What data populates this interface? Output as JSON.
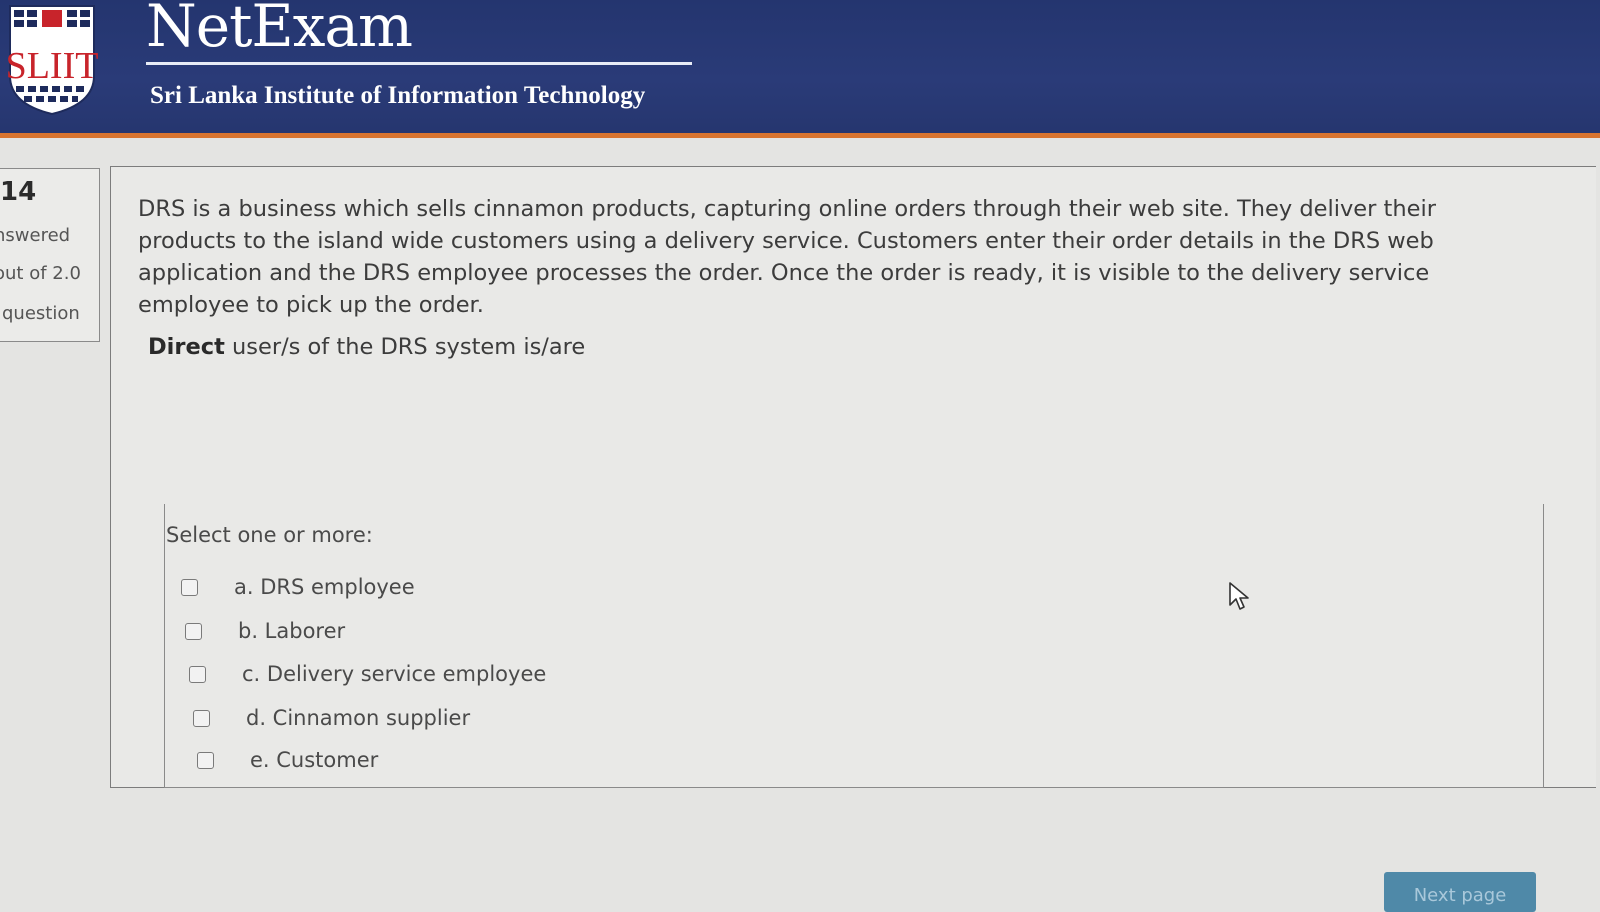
{
  "header": {
    "app_title": "NetExam",
    "subtitle": "Sri Lanka Institute of Information Technology",
    "logo_text": "SLIIT"
  },
  "info_panel": {
    "number": "14",
    "status": "nswered",
    "marks": "out of 2.0",
    "flag": "question"
  },
  "question": {
    "text": "DRS is a business which sells cinnamon products, capturing online orders through their web site. They deliver their products to the island wide customers using a delivery service. Customers enter their order details in the DRS web application and the DRS employee processes the order. Once the order is ready, it is visible to the delivery service employee to pick up the order.",
    "prompt_bold": "Direct",
    "prompt_rest": " user/s of the DRS system is/are"
  },
  "answer": {
    "instruction": "Select one or more:",
    "options": [
      {
        "label": "a. DRS employee",
        "checked": false
      },
      {
        "label": "b. Laborer",
        "checked": false
      },
      {
        "label": "c. Delivery service employee",
        "checked": false
      },
      {
        "label": "d. Cinnamon supplier",
        "checked": false
      },
      {
        "label": "e. Customer",
        "checked": false
      }
    ]
  },
  "navigation": {
    "next_label": "Next page"
  },
  "colors": {
    "header_bg": "#26366f",
    "header_accent": "#d8742f",
    "logo_red": "#c8242b",
    "page_bg": "#e4e4e2",
    "button_bg": "#4f89a8"
  }
}
